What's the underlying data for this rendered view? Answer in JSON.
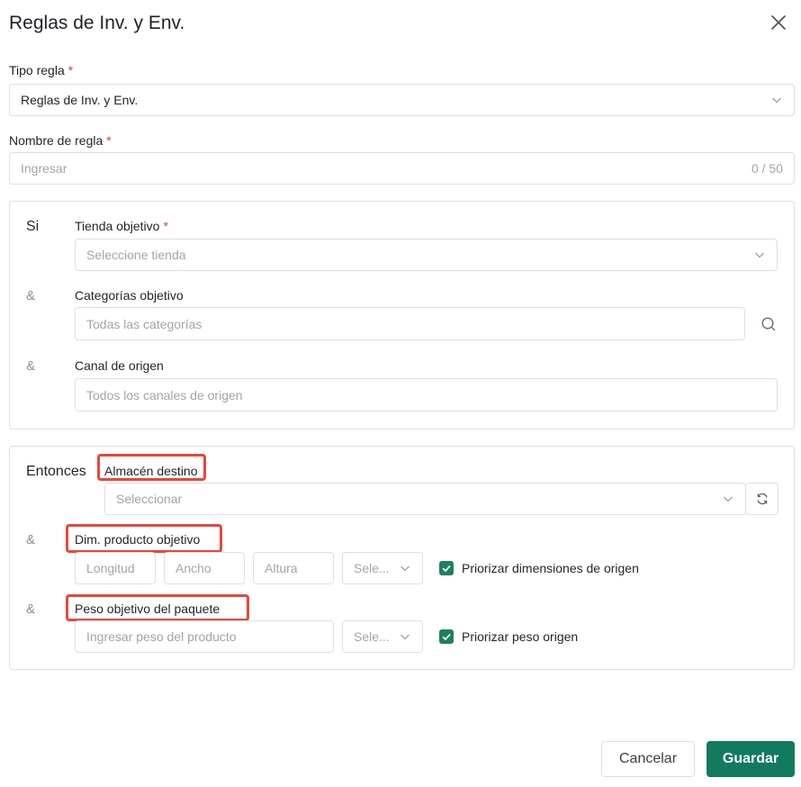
{
  "dialog": {
    "title": "Reglas de Inv. y Env."
  },
  "rule_type": {
    "label": "Tipo regla",
    "required_mark": "*",
    "value": "Reglas de Inv. y Env."
  },
  "rule_name": {
    "label": "Nombre de regla",
    "required_mark": "*",
    "placeholder": "Ingresar",
    "counter": "0 / 50"
  },
  "conditions": {
    "if_label": "Si",
    "and_mark": "&",
    "store": {
      "label": "Tienda objetivo",
      "required_mark": "*",
      "placeholder": "Seleccione tienda"
    },
    "categories": {
      "label": "Categorías objetivo",
      "placeholder": "Todas las categorías"
    },
    "channel": {
      "label": "Canal de origen",
      "placeholder": "Todos los canales de origen"
    }
  },
  "actions": {
    "then_label": "Entonces",
    "and_mark": "&",
    "warehouse": {
      "label": "Almacén destino",
      "placeholder": "Seleccionar"
    },
    "dimensions": {
      "label": "Dim. producto objetivo",
      "length_placeholder": "Longitud",
      "width_placeholder": "Ancho",
      "height_placeholder": "Altura",
      "unit_placeholder": "Sele...",
      "checkbox_label": "Priorizar dimensiones de origen",
      "checked": true
    },
    "weight": {
      "label": "Peso objetivo del paquete",
      "placeholder": "Ingresar peso del producto",
      "unit_placeholder": "Sele...",
      "checkbox_label": "Priorizar peso origen",
      "checked": true
    }
  },
  "footer": {
    "cancel_label": "Cancelar",
    "save_label": "Guardar"
  },
  "colors": {
    "accent": "#127a5e",
    "checkbox": "#1f7f62",
    "required": "#e03a3a",
    "highlight": "#e8463a",
    "border": "#dcdfe6",
    "placeholder": "#a0a4ab"
  },
  "icons": {
    "close": "close-icon",
    "chevron": "chevron-down-icon",
    "search": "search-icon",
    "refresh": "refresh-icon",
    "check": "check-icon"
  }
}
